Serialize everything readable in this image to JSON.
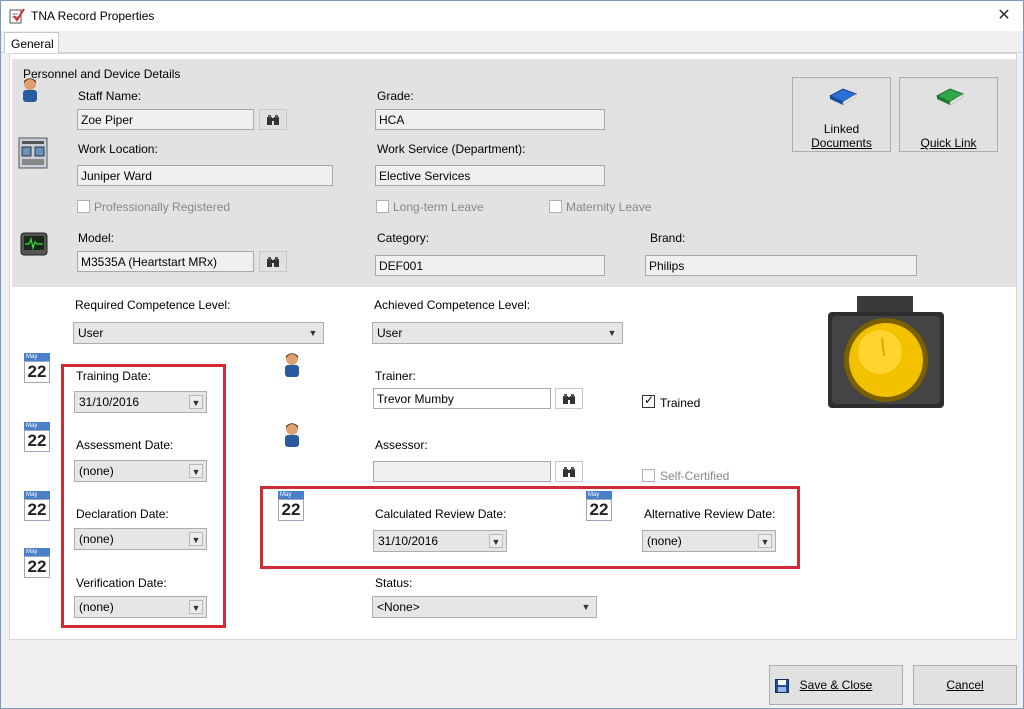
{
  "window": {
    "title": "TNA Record Properties",
    "close_glyph": "✕"
  },
  "tabs": [
    {
      "label": "General"
    }
  ],
  "personnel": {
    "group_title": "Personnel and Device Details",
    "staff_name_label": "Staff Name:",
    "staff_name_value": "Zoe Piper",
    "grade_label": "Grade:",
    "grade_value": "HCA",
    "work_location_label": "Work Location:",
    "work_location_value": "Juniper Ward",
    "work_service_label": "Work Service (Department):",
    "work_service_value": "Elective Services",
    "professionally_registered_label": "Professionally Registered",
    "long_term_leave_label": "Long-term Leave",
    "maternity_leave_label": "Maternity Leave",
    "model_label": "Model:",
    "model_value": "M3535A (Heartstart MRx)",
    "category_label": "Category:",
    "category_value": "DEF001",
    "brand_label": "Brand:",
    "brand_value": "Philips"
  },
  "quick_buttons": {
    "linked_documents_line1": "Linked",
    "linked_documents_line2": "Documents",
    "quick_link": "Quick Link"
  },
  "competence": {
    "required_label": "Required Competence Level:",
    "required_value": "User",
    "achieved_label": "Achieved Competence Level:",
    "achieved_value": "User"
  },
  "dates": {
    "cal_month": "May",
    "cal_day": "22",
    "training_label": "Training Date:",
    "training_value": "31/10/2016",
    "assessment_label": "Assessment Date:",
    "assessment_value": "(none)",
    "declaration_label": "Declaration Date:",
    "declaration_value": "(none)",
    "verification_label": "Verification Date:",
    "verification_value": "(none)",
    "calculated_review_label": "Calculated Review Date:",
    "calculated_review_value": "31/10/2016",
    "alternative_review_label": "Alternative Review Date:",
    "alternative_review_value": "(none)"
  },
  "trainer": {
    "label": "Trainer:",
    "value": "Trevor Mumby",
    "trained_label": "Trained",
    "trained_checked": true
  },
  "assessor": {
    "label": "Assessor:",
    "value": "",
    "self_certified_label": "Self-Certified",
    "self_certified_checked": false
  },
  "status": {
    "label": "Status:",
    "value": "<None>"
  },
  "traffic_light": {
    "state": "amber",
    "color": "#f2c200"
  },
  "footer": {
    "save_close": "Save & Close",
    "cancel": "Cancel"
  },
  "colors": {
    "highlight": "#d12b35",
    "accent": "#4a7fc9"
  }
}
